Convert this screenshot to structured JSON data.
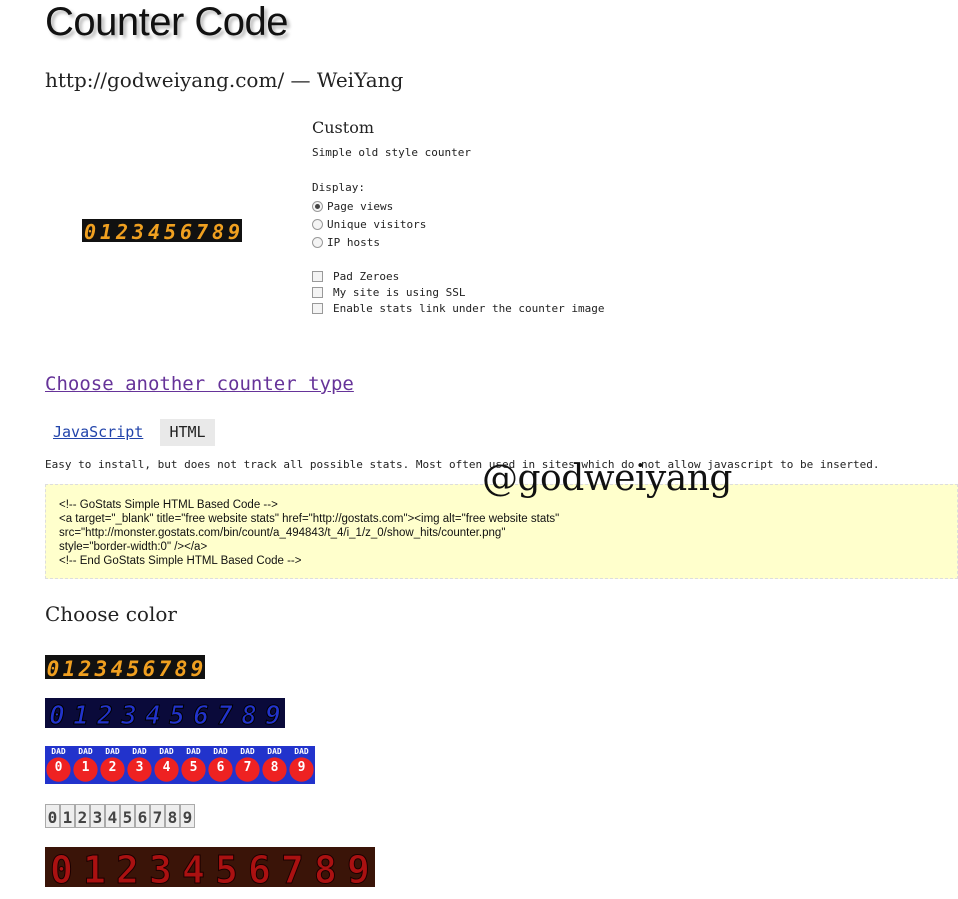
{
  "header": {
    "title": "Counter Code",
    "site_url": "http://godweiyang.com/",
    "site_sep": " — ",
    "site_name": "WeiYang"
  },
  "options": {
    "heading": "Custom",
    "description": "Simple old style counter",
    "display_label": "Display:",
    "display_options": [
      {
        "label": "Page views",
        "selected": true
      },
      {
        "label": "Unique visitors",
        "selected": false
      },
      {
        "label": "IP hosts",
        "selected": false
      }
    ],
    "checkboxes": [
      {
        "label": "Pad Zeroes",
        "checked": false
      },
      {
        "label": "My site is using SSL",
        "checked": false
      },
      {
        "label": "Enable stats link under the counter image",
        "checked": false
      }
    ]
  },
  "counter_digits": "0123456789",
  "another_link": "Choose another counter type",
  "tabs": {
    "javascript": "JavaScript",
    "html": "HTML",
    "active": "HTML"
  },
  "description": "Easy to install, but does not track all possible stats. Most often used in sites which do not allow javascript to be inserted.",
  "code_lines": [
    "<!-- GoStats Simple HTML Based Code -->",
    "<a target=\"_blank\" title=\"free website stats\" href=\"http://gostats.com\"><img alt=\"free website stats\"",
    "src=\"http://monster.gostats.com/bin/count/a_494843/t_4/i_1/z_0/show_hits/counter.png\"",
    "style=\"border-width:0\" /></a>",
    "<!-- End GoStats Simple HTML Based Code -->"
  ],
  "watermark": "@godweiyang",
  "color_heading": "Choose color",
  "color_styles": [
    {
      "name": "amber-led",
      "bg": "#111111",
      "fg": "#f0a020"
    },
    {
      "name": "blue-3d",
      "bg": "#0a0a3a",
      "fg": "#2233cc"
    },
    {
      "name": "pacman",
      "bg": "#2233cc",
      "fg": "#ee2222",
      "top_label": "DAD"
    },
    {
      "name": "gray-boxes",
      "bg": "#eeeeee",
      "fg": "#444444"
    },
    {
      "name": "dark-red",
      "bg": "#3a1408",
      "fg": "#aa1111"
    }
  ]
}
